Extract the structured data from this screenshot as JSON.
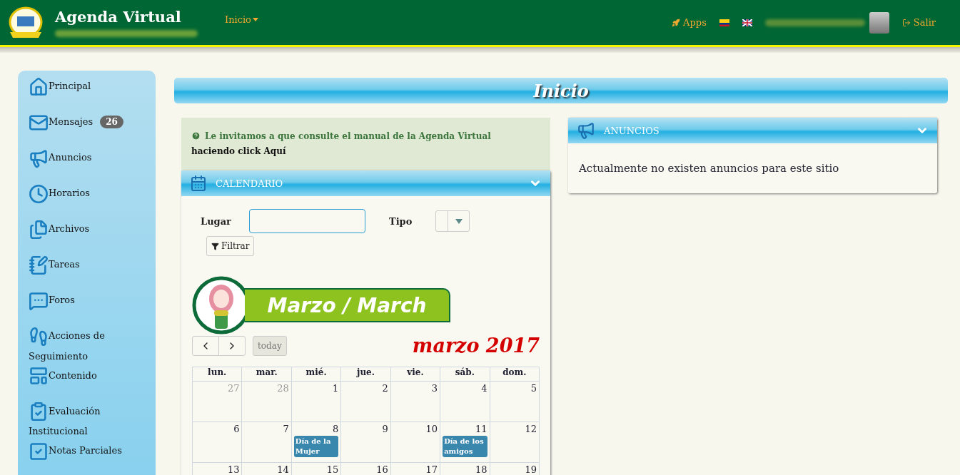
{
  "header": {
    "title": "Agenda Virtual",
    "nav": [
      {
        "label": "Inicio",
        "dropdown": true
      }
    ],
    "apps": "Apps",
    "flags": [
      {
        "kind": "colombia"
      },
      {
        "kind": "uk"
      }
    ],
    "logout": "Salir"
  },
  "sidebar": {
    "items": [
      {
        "label": "Principal",
        "kind": "home"
      },
      {
        "label": "Mensajes",
        "kind": "mail",
        "badge": "26"
      },
      {
        "label": "Anuncios",
        "kind": "megaphone"
      },
      {
        "label": "Horarios",
        "kind": "clock"
      },
      {
        "label": "Archivos",
        "kind": "files"
      },
      {
        "label": "Tareas",
        "kind": "notebook"
      },
      {
        "label": "Foros",
        "kind": "forum"
      },
      {
        "label": "Acciones de Seguimiento",
        "kind": "footprints"
      },
      {
        "label": "Contenido",
        "kind": "layout"
      },
      {
        "label": "Evaluación Institucional",
        "kind": "checklist"
      },
      {
        "label": "Notas Parciales",
        "kind": "check"
      }
    ]
  },
  "page_title": "Inicio",
  "notice": {
    "text": "Le invitamos a que consulte el manual de la Agenda Virtual",
    "link": "haciendo click Aquí"
  },
  "calendar_panel": {
    "title": "CALENDARIO",
    "expanded": true,
    "filters": {
      "place_label": "Lugar",
      "type_label": "Tipo",
      "filter_button": "Filtrar"
    },
    "month_banner": "Marzo / March",
    "today_button": {
      "label": "today",
      "disabled": true
    },
    "month_title": "marzo 2017",
    "weekdays": [
      "lun.",
      "mar.",
      "mié.",
      "jue.",
      "vie.",
      "sáb.",
      "dom."
    ],
    "weeks": [
      [
        {
          "day": "27",
          "other_month": true
        },
        {
          "day": "28",
          "other_month": true
        },
        {
          "day": "1",
          "other_month": false
        },
        {
          "day": "2",
          "other_month": false
        },
        {
          "day": "3",
          "other_month": false
        },
        {
          "day": "4",
          "other_month": false
        },
        {
          "day": "5",
          "other_month": false
        }
      ],
      [
        {
          "day": "6",
          "other_month": false
        },
        {
          "day": "7",
          "other_month": false
        },
        {
          "day": "8",
          "other_month": false,
          "events": [
            {
              "title": "Día de la Mujer",
              "color": "#3a87ad"
            }
          ]
        },
        {
          "day": "9",
          "other_month": false
        },
        {
          "day": "10",
          "other_month": false
        },
        {
          "day": "11",
          "other_month": false,
          "events": [
            {
              "title": "Día de los amigos",
              "color": "#3a87ad"
            }
          ]
        },
        {
          "day": "12",
          "other_month": false
        }
      ],
      [
        {
          "day": "13",
          "other_month": false
        },
        {
          "day": "14",
          "other_month": false
        },
        {
          "day": "15",
          "other_month": false
        },
        {
          "day": "16",
          "other_month": false
        },
        {
          "day": "17",
          "other_month": false
        },
        {
          "day": "18",
          "other_month": false
        },
        {
          "day": "19",
          "other_month": false
        }
      ]
    ]
  },
  "announcements_panel": {
    "title": "ANUNCIOS",
    "expanded": true,
    "message": "Actualmente no existen anuncios para este sitio"
  }
}
